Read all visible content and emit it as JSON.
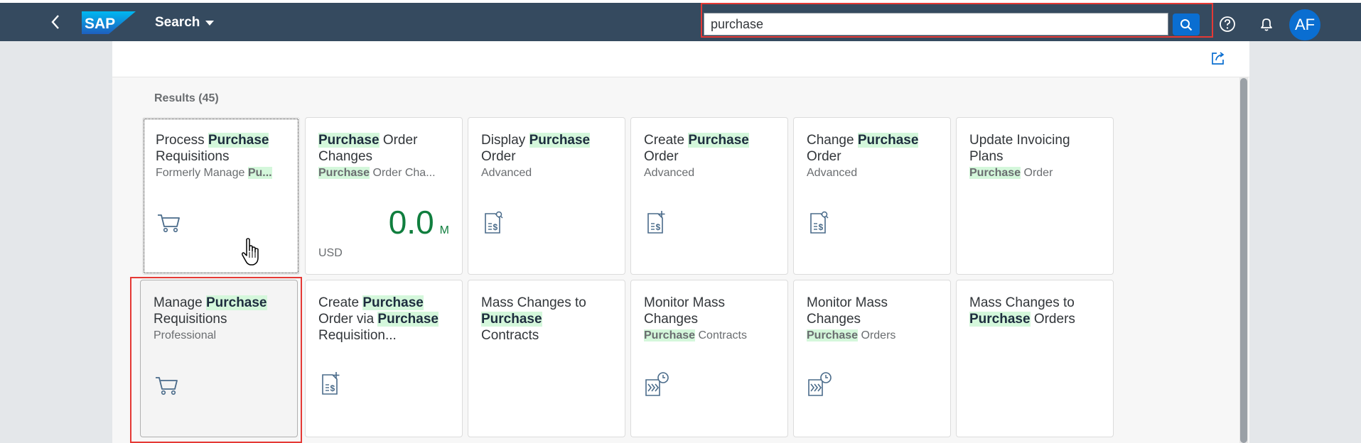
{
  "shell": {
    "logo_text": "SAP",
    "app_title": "Search",
    "search_value": "purchase",
    "avatar_initials": "AF",
    "icons": [
      "back-icon",
      "search-icon",
      "help-icon",
      "bell-icon"
    ]
  },
  "results": {
    "label": "Results (45)"
  },
  "tiles_row1": [
    {
      "pre": "Process ",
      "hl": "Purchase",
      "post": "",
      "line2": "Requisitions",
      "sub_pre": "Formerly Manage ",
      "sub_hl": "Pu...",
      "sub_post": "",
      "icon": "cart-icon"
    },
    {
      "pre": "",
      "hl": "Purchase",
      "post": " Order",
      "line2": "Changes",
      "sub_pre": "",
      "sub_hl": "Purchase",
      "sub_post": " Order Cha...",
      "kpi_value": "0.0",
      "kpi_scale": "M",
      "kpi_unit": "USD"
    },
    {
      "pre": "Display ",
      "hl": "Purchase",
      "post": "",
      "line2": "Order",
      "sub": "Advanced",
      "icon": "document-search-icon"
    },
    {
      "pre": "Create ",
      "hl": "Purchase",
      "post": "",
      "line2": "Order",
      "sub": "Advanced",
      "icon": "document-add-icon"
    },
    {
      "pre": "Change ",
      "hl": "Purchase",
      "post": "",
      "line2": "Order",
      "sub": "Advanced",
      "icon": "document-search-icon"
    },
    {
      "title": "Update Invoicing",
      "line2": "Plans",
      "sub_hl": "Purchase",
      "sub_post": " Order"
    }
  ],
  "tiles_row2": [
    {
      "pre": "Manage ",
      "hl": "Purchase",
      "line2": "Requisitions",
      "sub": "Professional",
      "icon": "cart-icon"
    },
    {
      "pre": "Create ",
      "hl": "Purchase",
      "line2_pre": "Order via ",
      "line2_hl": "Purchase",
      "line3": "Requisition...",
      "icon": "document-add-icon"
    },
    {
      "title": "Mass Changes to",
      "line2_hl": "Purchase",
      "line3": "Contracts"
    },
    {
      "title": "Monitor Mass",
      "line2": "Changes",
      "sub_hl": "Purchase",
      "sub_post": " Contracts",
      "icon": "mass-change-clock-icon"
    },
    {
      "title": "Monitor Mass",
      "line2": "Changes",
      "sub_hl": "Purchase",
      "sub_post": " Orders",
      "icon": "mass-change-clock-icon"
    },
    {
      "title": "Mass Changes to",
      "line2_hl": "Purchase",
      "line2_post": " Orders"
    }
  ]
}
